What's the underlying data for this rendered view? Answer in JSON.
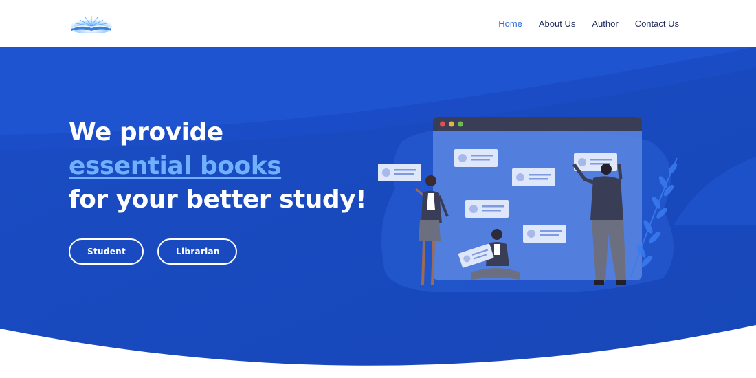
{
  "header": {
    "logo_icon": "open-book-logo",
    "nav": [
      {
        "label": "Home",
        "active": true
      },
      {
        "label": "About Us",
        "active": false
      },
      {
        "label": "Author",
        "active": false
      },
      {
        "label": "Contact Us",
        "active": false
      }
    ]
  },
  "hero": {
    "headline_line1": "We provide",
    "headline_highlight": "essential books",
    "headline_line3": "for your better study!",
    "buttons": {
      "student": "Student",
      "librarian": "Librarian"
    },
    "illustration": "people-posting-cards-on-browser-window-illustration"
  },
  "colors": {
    "hero_blue": "#1a4fc9",
    "highlight": "#6fb0ff",
    "nav_active": "#2a6fd6",
    "nav_text": "#1e2a5a"
  }
}
